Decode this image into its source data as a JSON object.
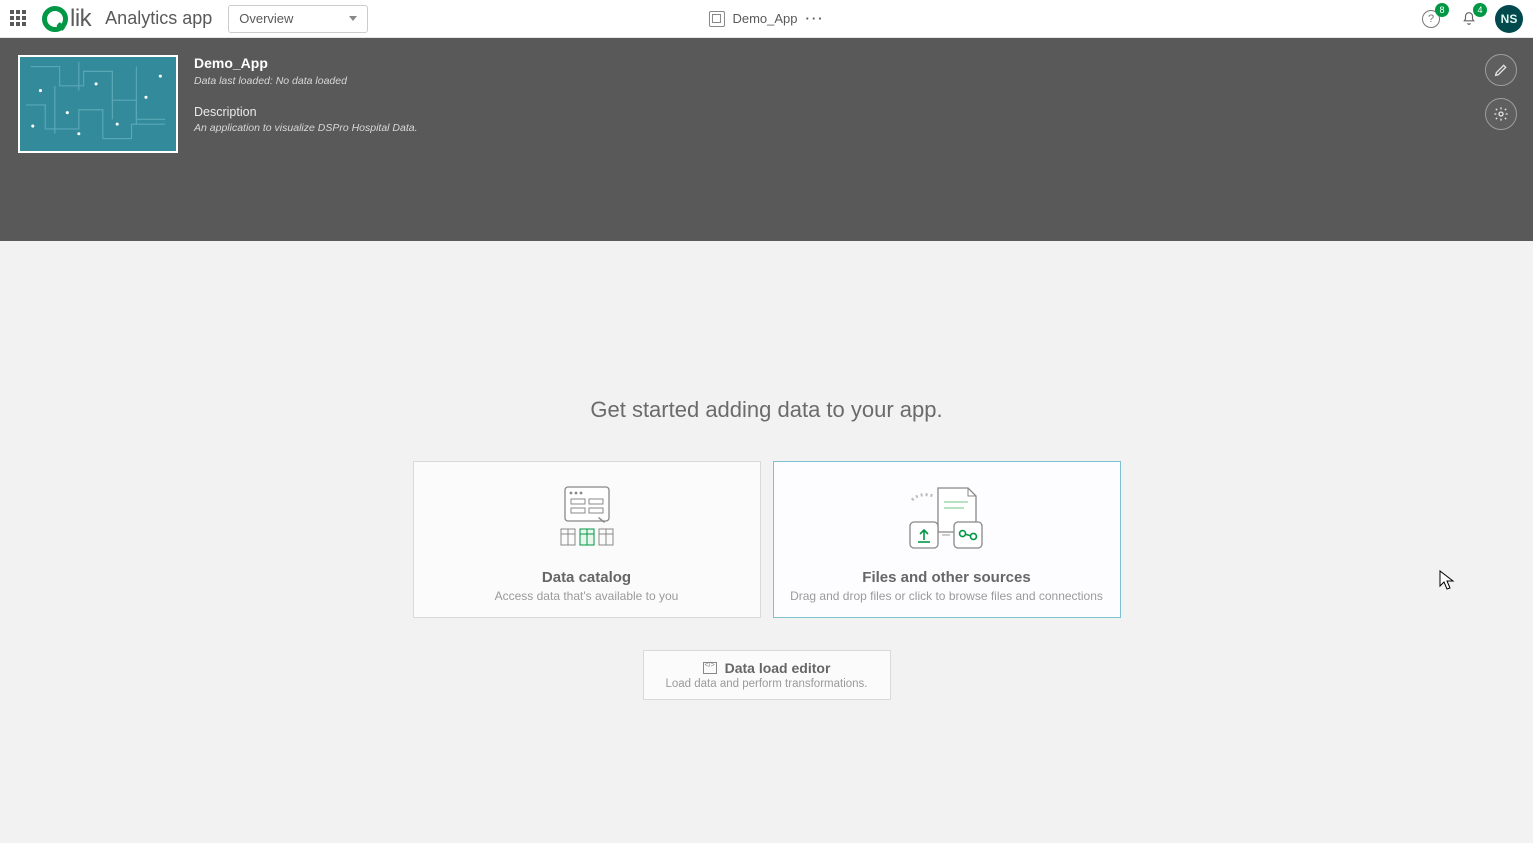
{
  "topbar": {
    "brand_word": "lik",
    "app_title": "Analytics app",
    "view_selected": "Overview",
    "center_app_name": "Demo_App",
    "help_badge": "8",
    "notif_badge": "4",
    "avatar_initials": "NS"
  },
  "dark": {
    "app_name": "Demo_App",
    "last_loaded": "Data last loaded: No data loaded",
    "desc_label": "Description",
    "description": "An application to visualize DSPro Hospital Data."
  },
  "main": {
    "headline": "Get started adding data to your app.",
    "card1_title": "Data catalog",
    "card1_sub": "Access data that's available to you",
    "card2_title": "Files and other sources",
    "card2_sub": "Drag and drop files or click to browse files and connections",
    "dle_title": "Data load editor",
    "dle_sub": "Load data and perform transformations."
  }
}
